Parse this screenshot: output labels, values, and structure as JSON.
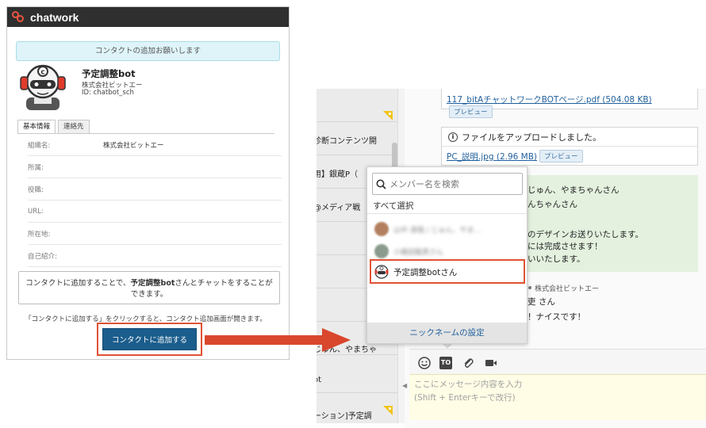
{
  "left": {
    "logo_text": "chatwork",
    "banner": "コンタクトの追加お願いします",
    "profile": {
      "name": "予定調整bot",
      "company": "株式会社ビットエー",
      "id_line": "ID: chatbot_sch"
    },
    "tabs": [
      "基本情報",
      "連絡先"
    ],
    "info_rows": [
      {
        "label": "組織名:",
        "value": "株式会社ビットエー"
      },
      {
        "label": "所属:",
        "value": ""
      },
      {
        "label": "役職:",
        "value": ""
      },
      {
        "label": "URL:",
        "value": ""
      },
      {
        "label": "所在地:",
        "value": ""
      },
      {
        "label": "自己紹介:",
        "value": ""
      }
    ],
    "notice": {
      "pre": "コンタクトに追加することで、",
      "bold": "予定調整bot",
      "post": "さんとチャットをすることができます。"
    },
    "hint": "「コンタクトに追加する」をクリックすると、コンタクト追加画面が開きます。",
    "add_button": "コンタクトに追加する"
  },
  "sidebar": {
    "items": [
      {
        "text": "",
        "flag": true
      },
      {
        "text": "診断コンテンツ開",
        "flag": false
      },
      {
        "text": "用】銀蔵P（",
        "flag": false
      },
      {
        "text": "@メディア戦",
        "flag": false
      },
      {
        "text": "",
        "flag": false
      },
      {
        "text": "",
        "flag": false
      },
      {
        "text": "",
        "flag": false
      },
      {
        "text": "じゅん、やまちゃ",
        "flag": false
      },
      {
        "text": "ot",
        "flag": false
      },
      {
        "text": "ーション]予定調",
        "flag": true
      }
    ]
  },
  "chat": {
    "file1": {
      "name": "117_bitAチャットワークBOTページ.pdf",
      "size": "(504.08 KB)",
      "preview": "プレビュー"
    },
    "upload_header": "ファイルをアップロードしました。",
    "file2": {
      "name": "PC_説明.jpg",
      "size": "(2.96 MB)",
      "preview": "プレビュー"
    },
    "message_lines": [
      "じゅん、やまちゃんさん",
      "んちゃんさん",
      "のデザインお送りいたします。",
      "には完成させます！",
      "いいたします。"
    ],
    "sender_company": "株式会社ビットエー",
    "partial_lines": [
      "吏 さん",
      "！ナイスです！"
    ],
    "compose_placeholder": "ここにメッセージ内容を入力",
    "compose_hint": "(Shift + Enterキーで改行)",
    "to_label": "TO"
  },
  "popup": {
    "search_placeholder": "メンバー名を検索",
    "select_all": "すべて選択",
    "blurred_members": [
      {
        "name": "山中 達哉 / じゅん、やま...",
        "avatar_color": "#b28060"
      },
      {
        "name": "小橋田龍男さん",
        "avatar_color": "#8a9a8c"
      }
    ],
    "highlighted_member": "予定調整botさん",
    "footer": "ニックネームの設定"
  },
  "colors": {
    "highlight": "#e05234",
    "button_blue": "#1b5d8c",
    "header_dark": "#2f2f2f",
    "link_blue": "#1f5f9c"
  }
}
